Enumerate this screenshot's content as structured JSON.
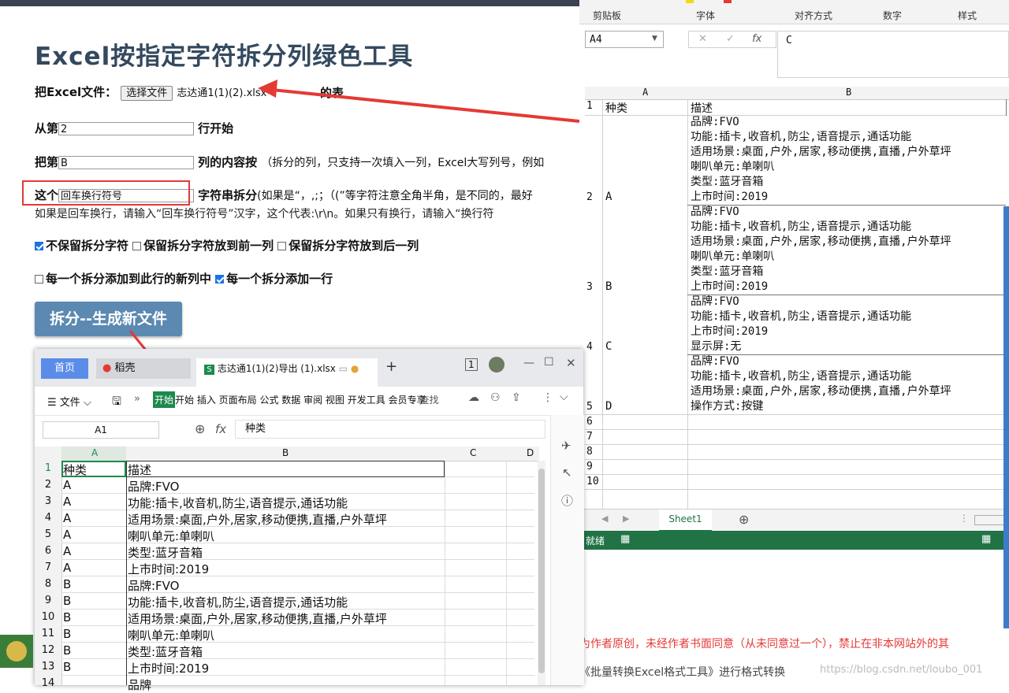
{
  "page": {
    "title": "Excel按指定字符拆分列绿色工具",
    "file_label": "把Excel文件：",
    "file_button": "选择文件",
    "file_name": "志达通1(1)(2).xlsx",
    "file_suffix": "的表",
    "start_row_prefix": "从第",
    "start_row_value": "2",
    "start_row_suffix": "行开始",
    "column_prefix": "把第",
    "column_value": "B",
    "column_suffix": "列的内容按",
    "column_hint": "（拆分的列，只支持一次填入一列，Excel大写列号，例如",
    "char_prefix": "这个",
    "char_value": "回车换行符号",
    "char_suffix": "字符串拆分",
    "char_hint": "(如果是“，,;；（(”等字符注意全角半角，是不同的，最好",
    "char_hint2": "如果是回车换行，请输入“回车换行符号”汉字，这个代表:\\r\\n。如果只有换行，请输入“换行符",
    "opt_no_keep": "不保留拆分字符",
    "opt_keep_prev": "保留拆分字符放到前一列",
    "opt_keep_next": "保留拆分字符放到后一列",
    "opt_new_col": "每一个拆分添加到此行的新列中",
    "opt_new_row": "每一个拆分添加一行",
    "split_button": "拆分--生成新文件"
  },
  "checkboxes": {
    "no_keep": true,
    "keep_prev": false,
    "keep_next": false,
    "new_col": false,
    "new_row": true
  },
  "excel": {
    "ribbon": [
      "剪贴板",
      "字体",
      "对齐方式",
      "数字",
      "样式"
    ],
    "name_box": "A4",
    "formula": "C",
    "col_a": "A",
    "col_b": "B",
    "row_nums": [
      "1",
      "2",
      "3",
      "4",
      "5",
      "6",
      "7",
      "8",
      "9",
      "10"
    ],
    "header": [
      "种类",
      "描述"
    ],
    "rows": [
      {
        "a": "A",
        "b": [
          "品牌:FVO",
          "功能:插卡,收音机,防尘,语音提示,通话功能",
          "适用场景:桌面,户外,居家,移动便携,直播,户外草坪",
          "喇叭单元:单喇叭",
          "类型:蓝牙音箱",
          "上市时间:2019"
        ]
      },
      {
        "a": "B",
        "b": [
          "品牌:FVO",
          "功能:插卡,收音机,防尘,语音提示,通话功能",
          "适用场景:桌面,户外,居家,移动便携,直播,户外草坪",
          "喇叭单元:单喇叭",
          "类型:蓝牙音箱",
          "上市时间:2019"
        ]
      },
      {
        "a": "C",
        "b": [
          "品牌:FVO",
          "功能:插卡,收音机,防尘,语音提示,通话功能",
          "上市时间:2019",
          "显示屏:无"
        ]
      },
      {
        "a": "D",
        "b": [
          "品牌:FVO",
          "功能:插卡,收音机,防尘,语音提示,通话功能",
          "适用场景:桌面,户外,居家,移动便携,直播,户外草坪",
          "操作方式:按键"
        ]
      }
    ],
    "sheet_tab": "Sheet1",
    "status": "就绪",
    "footer_red": "为作者原创，未经作者书面同意（从未同意过一个），禁止在非本网站外的其",
    "footer_gray": "《批量转换Excel格式工具》进行格式转换",
    "watermark": "https://blog.csdn.net/loubo_001"
  },
  "wps": {
    "tab_home": "首页",
    "tab_daoke": "稻壳",
    "tab_file": "志达通1(1)(2)导出 (1).xlsx",
    "menu_file": "文件",
    "menu_items": "开始 插入 页面布局 公式 数据 审阅 视图 开发工具 会员专享",
    "menu_start": "开始",
    "search": "查找",
    "name_box": "A1",
    "fx": "fx",
    "formula": "种类",
    "cols": [
      "A",
      "B",
      "C",
      "D"
    ],
    "rows": [
      [
        "1",
        "种类",
        "描述"
      ],
      [
        "2",
        "A",
        "品牌:FVO"
      ],
      [
        "3",
        "A",
        "功能:插卡,收音机,防尘,语音提示,通话功能"
      ],
      [
        "4",
        "A",
        "适用场景:桌面,户外,居家,移动便携,直播,户外草坪"
      ],
      [
        "5",
        "A",
        "喇叭单元:单喇叭"
      ],
      [
        "6",
        "A",
        "类型:蓝牙音箱"
      ],
      [
        "7",
        "A",
        "上市时间:2019"
      ],
      [
        "8",
        "B",
        "品牌:FVO"
      ],
      [
        "9",
        "B",
        "功能:插卡,收音机,防尘,语音提示,通话功能"
      ],
      [
        "10",
        "B",
        "适用场景:桌面,户外,居家,移动便携,直播,户外草坪"
      ],
      [
        "11",
        "B",
        "喇叭单元:单喇叭"
      ],
      [
        "12",
        "B",
        "类型:蓝牙音箱"
      ],
      [
        "13",
        "B",
        "上市时间:2019"
      ]
    ],
    "extra_row": "品牌"
  },
  "colors": {
    "accent_red": "#e53935",
    "excel_green": "#217346",
    "wps_green": "#1c8a4c",
    "button_blue": "#5b89b2"
  }
}
